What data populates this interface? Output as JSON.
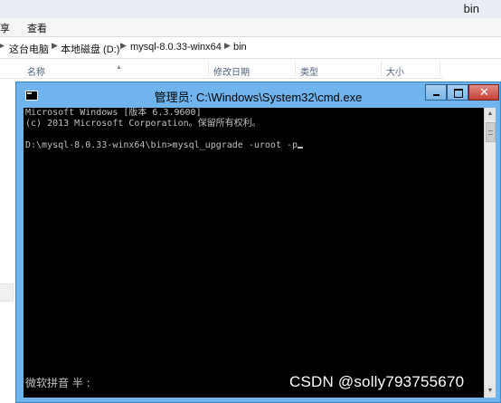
{
  "explorer": {
    "title": "bin",
    "ribbon": {
      "share": "享",
      "view": "查看"
    },
    "breadcrumb": [
      "这台电脑",
      "本地磁盘 (D:)",
      "mysql-8.0.33-winx64",
      "bin"
    ],
    "columns": {
      "name": "名称",
      "modified": "修改日期",
      "type": "类型",
      "size": "大小"
    }
  },
  "cmd": {
    "title": "管理员: C:\\Windows\\System32\\cmd.exe",
    "lines": [
      "Microsoft Windows [版本 6.3.9600]",
      "(c) 2013 Microsoft Corporation。保留所有权利。",
      "",
      "D:\\mysql-8.0.33-winx64\\bin>mysql_upgrade -uroot -p"
    ],
    "ime_status": "微软拼音 半 :"
  },
  "watermark": "CSDN @solly793755670"
}
